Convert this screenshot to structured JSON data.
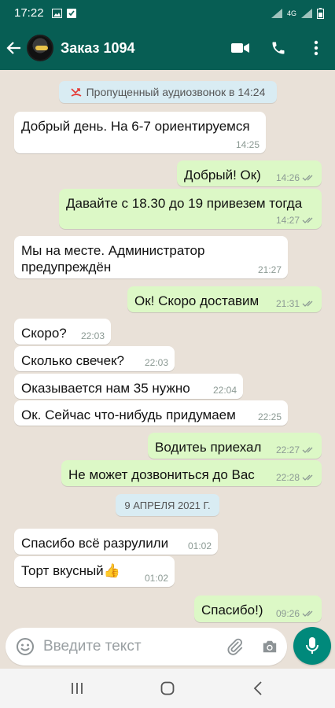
{
  "status": {
    "time": "17:22",
    "network": "4G"
  },
  "header": {
    "title": "Заказ 1094"
  },
  "system_note": {
    "text": "Пропущенный аудиозвонок в 14:24"
  },
  "messages": [
    {
      "dir": "in",
      "text": "Добрый день. На 6-7 ориентируемся",
      "time": "14:25"
    },
    {
      "dir": "out",
      "text": "Добрый! Ок)",
      "time": "14:26"
    },
    {
      "dir": "out",
      "text": "Давайте с 18.30 до 19 привезем тогда",
      "time": "14:27"
    },
    {
      "dir": "in",
      "text": "Мы на месте. Администратор предупреждён",
      "time": "21:27"
    },
    {
      "dir": "out",
      "text": "Ок! Скоро доставим",
      "time": "21:31"
    },
    {
      "dir": "in",
      "text": "Скоро?",
      "time": "22:03"
    },
    {
      "dir": "in",
      "text": "Сколько свечек?",
      "time": "22:03"
    },
    {
      "dir": "in",
      "text": "Оказывается нам 35 нужно",
      "time": "22:04"
    },
    {
      "dir": "in",
      "text": "Ок. Сейчас что-нибудь придумаем",
      "time": "22:25"
    },
    {
      "dir": "out",
      "text": "Водитеь приехал",
      "time": "22:27"
    },
    {
      "dir": "out",
      "text": "Не может дозвониться до Вас",
      "time": "22:28"
    },
    {
      "dir": "in",
      "text": "Спасибо всё разрулили",
      "time": "01:02"
    },
    {
      "dir": "in",
      "text": "Торт вкусный👍",
      "time": "01:02"
    },
    {
      "dir": "out",
      "text": "Спасибо!)",
      "time": "09:26"
    }
  ],
  "date_divider": {
    "text": "9 АПРЕЛЯ 2021 Г."
  },
  "composer": {
    "placeholder": "Введите текст"
  },
  "colors": {
    "header": "#075e54",
    "outgoing": "#dcf8c6",
    "incoming": "#ffffff",
    "accent": "#00897b",
    "read_ticks": "#8c9a94"
  },
  "icons": [
    "back-arrow-icon",
    "video-call-icon",
    "phone-icon",
    "menu-icon",
    "missed-call-icon",
    "emoji-icon",
    "attach-icon",
    "camera-icon",
    "mic-icon",
    "nav-recent-icon",
    "nav-home-icon",
    "nav-back-icon"
  ]
}
